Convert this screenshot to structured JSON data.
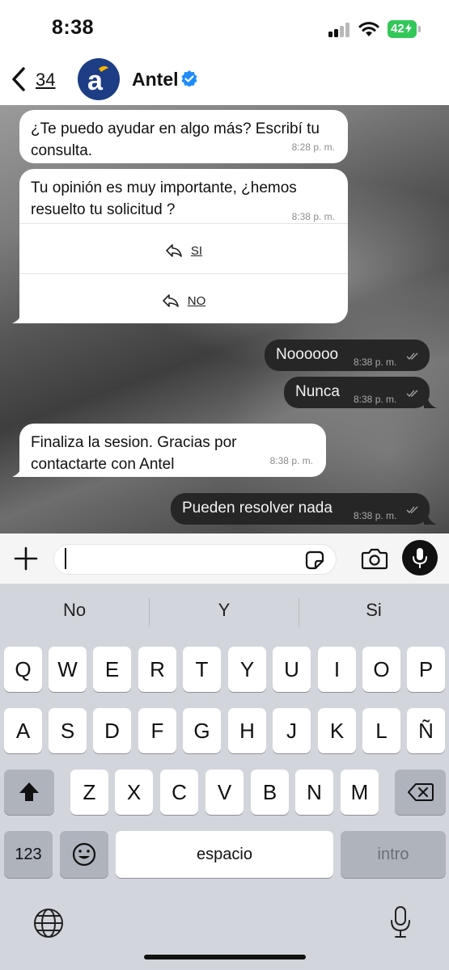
{
  "status_bar": {
    "time": "8:38",
    "battery": "42"
  },
  "header": {
    "back_count": "34",
    "contact_name": "Antel",
    "avatar_letter": "a"
  },
  "messages": [
    {
      "direction": "incoming",
      "text_lines": [
        "¿Te puedo ayudar en algo más? Escribí tu",
        "consulta."
      ],
      "time": "8:28 p. m."
    },
    {
      "direction": "incoming",
      "text_lines": [
        "Tu opinión es muy importante, ¿hemos",
        "resuelto tu solicitud ?"
      ],
      "time": "8:38 p. m.",
      "quick_replies": [
        "SI",
        "NO"
      ]
    },
    {
      "direction": "outgoing",
      "text": "Noooooo",
      "time": "8:38 p. m."
    },
    {
      "direction": "outgoing",
      "text": "Nunca",
      "time": "8:38 p. m."
    },
    {
      "direction": "incoming",
      "text_lines": [
        "Finaliza la sesion. Gracias por",
        "contactarte con Antel"
      ],
      "time": "8:38 p. m."
    },
    {
      "direction": "outgoing",
      "text": "Pueden resolver nada",
      "time": "8:38 p. m."
    }
  ],
  "composer": {
    "value": ""
  },
  "keyboard": {
    "suggestions": [
      "No",
      "Y",
      "Si"
    ],
    "rows": [
      [
        "Q",
        "W",
        "E",
        "R",
        "T",
        "Y",
        "U",
        "I",
        "O",
        "P"
      ],
      [
        "A",
        "S",
        "D",
        "F",
        "G",
        "H",
        "J",
        "K",
        "L",
        "Ñ"
      ],
      [
        "Z",
        "X",
        "C",
        "V",
        "B",
        "N",
        "M"
      ]
    ],
    "numbers_label": "123",
    "space_label": "espacio",
    "enter_label": "intro"
  },
  "colors": {
    "battery": "#33c759",
    "verified": "#1d8cf8",
    "brand_blue": "#1d3d84",
    "brand_yellow": "#f6b600",
    "outgoing_bubble": "#262626"
  },
  "icons": [
    "back-chevron-icon",
    "verified-badge-icon",
    "reply-arrow-icon",
    "double-check-icon",
    "plus-icon",
    "sticker-icon",
    "camera-icon",
    "mic-icon",
    "shift-icon",
    "backspace-icon",
    "emoji-icon",
    "globe-icon",
    "dictation-mic-icon"
  ]
}
